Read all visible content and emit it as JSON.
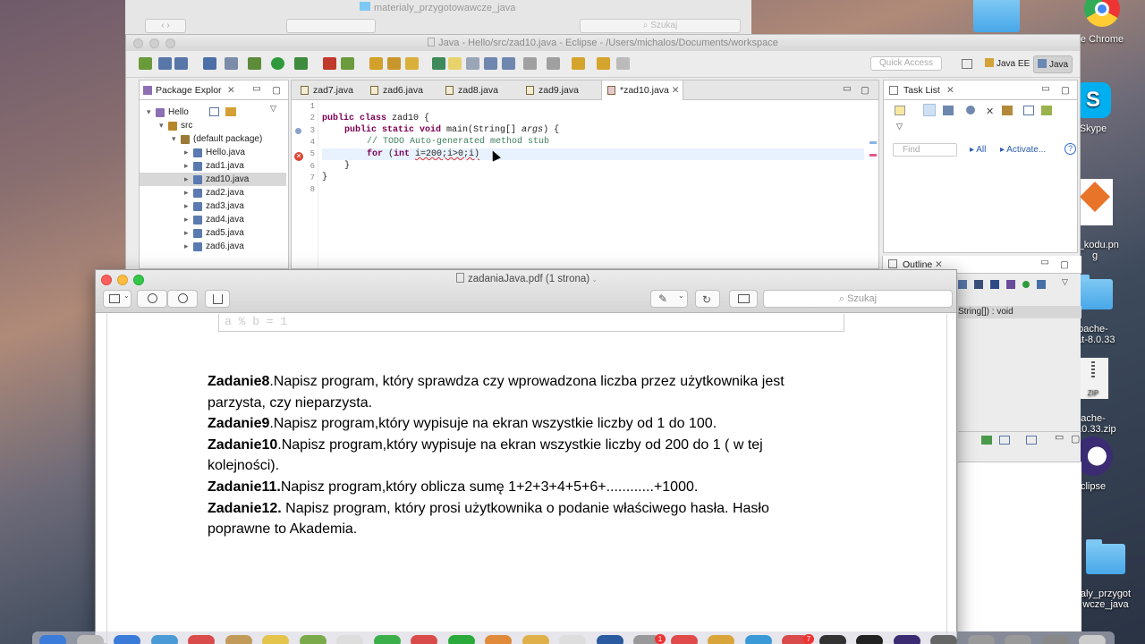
{
  "finder": {
    "title": "materialy_przygotowawcze_java",
    "search": "Szukaj"
  },
  "desktop": {
    "icons": [
      {
        "label": "Google Chrome",
        "display": "e Chrome"
      },
      {
        "label": "Skype",
        "display": "Skype"
      },
      {
        "label": "zadania_kodu.png",
        "display": "ia_kodu.pn\ng"
      },
      {
        "label": "apache-tomcat-8.0.33",
        "display": "pache-\ncat-8.0.33"
      },
      {
        "label": "apache-tomcat-8.0.33.zip",
        "display": "ache-\n-8.0.33.zip"
      },
      {
        "label": "Eclipse",
        "display": "clipse"
      },
      {
        "label": "materialy_przygotowawcze_java",
        "display": "aly_przygot\nwcze_java"
      }
    ],
    "zip_badge": "ZIP"
  },
  "eclipse": {
    "title": "Java - Hello/src/zad10.java - Eclipse - /Users/michalos/Documents/workspace",
    "quick_access": "Quick Access",
    "perspectives": [
      "Java EE",
      "Java"
    ],
    "package_explorer": {
      "tab": "Package Explor",
      "tree": [
        {
          "label": "Hello",
          "level": 0
        },
        {
          "label": "src",
          "level": 1
        },
        {
          "label": "(default package)",
          "level": 2
        },
        {
          "label": "Hello.java",
          "level": 3
        },
        {
          "label": "zad1.java",
          "level": 3
        },
        {
          "label": "zad10.java",
          "level": 3,
          "selected": true
        },
        {
          "label": "zad2.java",
          "level": 3
        },
        {
          "label": "zad3.java",
          "level": 3
        },
        {
          "label": "zad4.java",
          "level": 3
        },
        {
          "label": "zad5.java",
          "level": 3
        },
        {
          "label": "zad6.java",
          "level": 3
        }
      ]
    },
    "editor_tabs": [
      "zad7.java",
      "zad6.java",
      "zad8.java",
      "zad9.java",
      "*zad10.java"
    ],
    "active_tab": "*zad10.java",
    "line_numbers": [
      "1",
      "2",
      "3",
      "4",
      "5",
      "6",
      "7",
      "8"
    ],
    "code": {
      "l2a": "public class ",
      "l2b": "zad10 {",
      "l3a": "public static void ",
      "l3b": "main(String[] ",
      "l3c": "args",
      ") ": "",
      "l3d": ") {",
      "l4": "// TODO Auto-generated method stub",
      "l5a": "for ",
      "l5b": "(",
      "l5c": "int ",
      "l5d": "i=200;i>0;i)",
      "l6": "}",
      "l7": "}"
    },
    "task_list": {
      "tab": "Task List",
      "find": "Find",
      "all": "All",
      "activate": "Activate..."
    },
    "outline": {
      "tab": "Outline",
      "item": "String[]) : void"
    }
  },
  "preview": {
    "title": "zadaniaJava.pdf (1 strona)",
    "search": "Szukaj",
    "faded_formula": "a % b = 1",
    "lines": [
      {
        "bold": "Zadanie8",
        "text": ".Napisz program, który sprawdza czy wprowadzona liczba przez użytkownika jest"
      },
      {
        "bold": "",
        "text": "parzysta, czy nieparzysta."
      },
      {
        "bold": "Zadanie9",
        "text": ".Napisz program,który wypisuje na ekran wszystkie liczby od 1 do 100."
      },
      {
        "bold": "Zadanie10",
        "text": ".Napisz program,który wypisuje na ekran wszystkie liczby od 200 do 1 ( w tej"
      },
      {
        "bold": "",
        "text": "kolejności)."
      },
      {
        "bold": "Zadanie11.",
        "text": "Napisz program,który oblicza sumę 1+2+3+4+5+6+............+1000."
      },
      {
        "bold": "Zadanie12.",
        "text": " Napisz program, który prosi użytkownika o podanie właściwego hasła. Hasło"
      },
      {
        "bold": "",
        "text": "poprawne to Akademia."
      }
    ]
  },
  "dock": {
    "badges": [
      "1",
      "7"
    ]
  }
}
